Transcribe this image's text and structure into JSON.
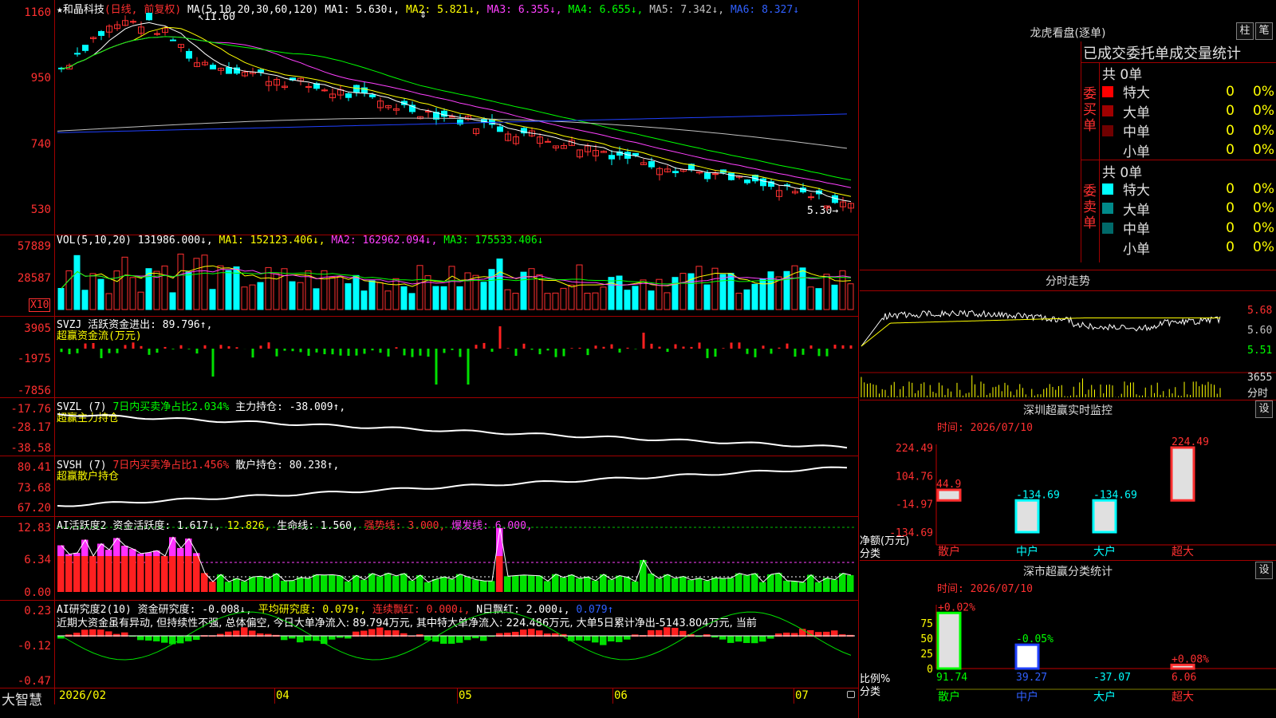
{
  "stock": {
    "star": "★",
    "name": "和晶科技",
    "mode": "(日线, 前复权)",
    "ma_label": "MA(5,10,20,30,60,120)",
    "ma1": "MA1: 5.630↓,",
    "ma2": "MA2: 5.821↓,",
    "ma3": "MA3: 6.355↓,",
    "ma4": "MA4: 6.655↓,",
    "ma5": "MA5: 7.342↓,",
    "ma6": "MA6: 8.327↓",
    "high_mark": "11.60",
    "low_mark": "5.30"
  },
  "colors": {
    "up": "#ff3030",
    "down": "#00ffff",
    "ma1": "#ffffff",
    "ma2": "#ffff00",
    "ma3": "#ff40ff",
    "ma4": "#00ff00",
    "ma5": "#c0c0c0",
    "ma6": "#2040ff",
    "grid": "#a00000"
  },
  "price_axis": [
    "1160",
    "950",
    "740",
    "530"
  ],
  "volume": {
    "label": "VOL(5,10,20)",
    "value": "131986.000↓,",
    "ma1": "MA1: 152123.406↓,",
    "ma2": "MA2: 162962.094↓,",
    "ma3": "MA3: 175533.406↓",
    "axis": [
      "57889",
      "28587"
    ],
    "unit": "X10"
  },
  "svzj": {
    "label": "SVZJ",
    "title": "活跃资金进出: 89.796↑,",
    "sub": "超赢资金流(万元)",
    "axis": [
      "3905",
      "-1975",
      "-7856"
    ]
  },
  "svzl": {
    "label": "SVZL (7)",
    "title": "7日内买卖净占比2.034%",
    "value": "主力持仓: -38.009↑,",
    "sub": "超赢主力持仓",
    "axis": [
      "-17.76",
      "-28.17",
      "-38.58"
    ]
  },
  "svsh": {
    "label": "SVSH (7)",
    "title": "7日内买卖净占比1.456%",
    "value": "散户持仓: 80.238↑,",
    "sub": "超赢散户持仓",
    "axis": [
      "80.41",
      "73.68",
      "67.20"
    ]
  },
  "ai1": {
    "label": "AI活跃度2",
    "v1": "资金活跃度: 1.617↓,",
    "v2": "12.826,",
    "v3": "生命线: 1.560,",
    "v4": "强势线: 3.000,",
    "v5": "爆发线: 6.000,",
    "axis": [
      "12.83",
      "6.34",
      "0.00"
    ]
  },
  "ai2": {
    "label": "AI研究度2(10)",
    "v1": "资金研究度: -0.008↓,",
    "v2": "平均研究度: 0.079↑,",
    "v3": "连续飘红: 0.000↓,",
    "v4": "N日飘红: 2.000↓,",
    "v5": "0.079↑",
    "comment": "近期大资金虽有异动, 但持续性不强, 总体偏空, 今日大单净流入: 89.794万元, 其中特大单净流入: 224.486万元, 大单5日累计净出-5143.804万元, 当前",
    "axis": [
      "0.23",
      "-0.12",
      "-0.47"
    ]
  },
  "bottom": {
    "brand": "大智慧",
    "dates": [
      "2026/02",
      "04",
      "05",
      "06",
      "07"
    ]
  },
  "lhb": {
    "title": "龙虎看盘(逐单)",
    "btn1": "柱",
    "btn2": "笔",
    "header": "已成交委托单成交量统计",
    "buy_side": "委买单",
    "sell_side": "委卖单",
    "buy_total": "共 0单",
    "sell_total": "共 0单",
    "buy_rows": [
      {
        "label": "特大",
        "count": "0",
        "pct": "0%",
        "color": "#ff0000"
      },
      {
        "label": "大单",
        "count": "0",
        "pct": "0%",
        "color": "#a00000"
      },
      {
        "label": "中单",
        "count": "0",
        "pct": "0%",
        "color": "#700000"
      },
      {
        "label": "小单",
        "count": "0",
        "pct": "0%",
        "color": "#000000"
      }
    ],
    "sell_rows": [
      {
        "label": "特大",
        "count": "0",
        "pct": "0%",
        "color": "#00ffff"
      },
      {
        "label": "大单",
        "count": "0",
        "pct": "0%",
        "color": "#008a8a"
      },
      {
        "label": "中单",
        "count": "0",
        "pct": "0%",
        "color": "#006a6a"
      },
      {
        "label": "小单",
        "count": "0",
        "pct": "0%",
        "color": "#000000"
      }
    ]
  },
  "fenshi": {
    "title": "分时走势",
    "axis": [
      "5.68",
      "5.60",
      "5.51"
    ],
    "vol_axis": [
      "3655",
      "分时"
    ]
  },
  "sz_monitor": {
    "title": "深圳超赢实时监控",
    "btn": "设",
    "time": "时间: 2026/07/10",
    "axis": [
      "224.49",
      "104.76",
      "-14.97",
      "-134.69"
    ],
    "ylabel": "净额(万元)",
    "xlabel": "分类",
    "categories": [
      "散户",
      "中户",
      "大户",
      "超大"
    ],
    "values": [
      "44.9",
      "-134.69",
      "-134.69",
      "224.49"
    ]
  },
  "sz_stats": {
    "title": "深市超赢分类统计",
    "btn": "设",
    "time": "时间: 2026/07/10",
    "axis": [
      "75",
      "50",
      "25",
      "0"
    ],
    "ylabel": "比例%",
    "xlabel": "分类",
    "categories": [
      "散户",
      "中户",
      "大户",
      "超大"
    ],
    "values": [
      "91.74",
      "39.27",
      "-37.07",
      "6.06"
    ],
    "deltas": [
      "+0.02%",
      "-0.05%",
      "",
      "+0.08%"
    ]
  },
  "chart_data": {
    "type": "bar",
    "title": "深圳超赢实时监控",
    "categories": [
      "散户",
      "中户",
      "大户",
      "超大"
    ],
    "values": [
      44.9,
      -134.69,
      -134.69,
      224.49
    ],
    "ylabel": "净额(万元)",
    "xlabel": "分类",
    "ylim": [
      -134.69,
      224.49
    ]
  }
}
